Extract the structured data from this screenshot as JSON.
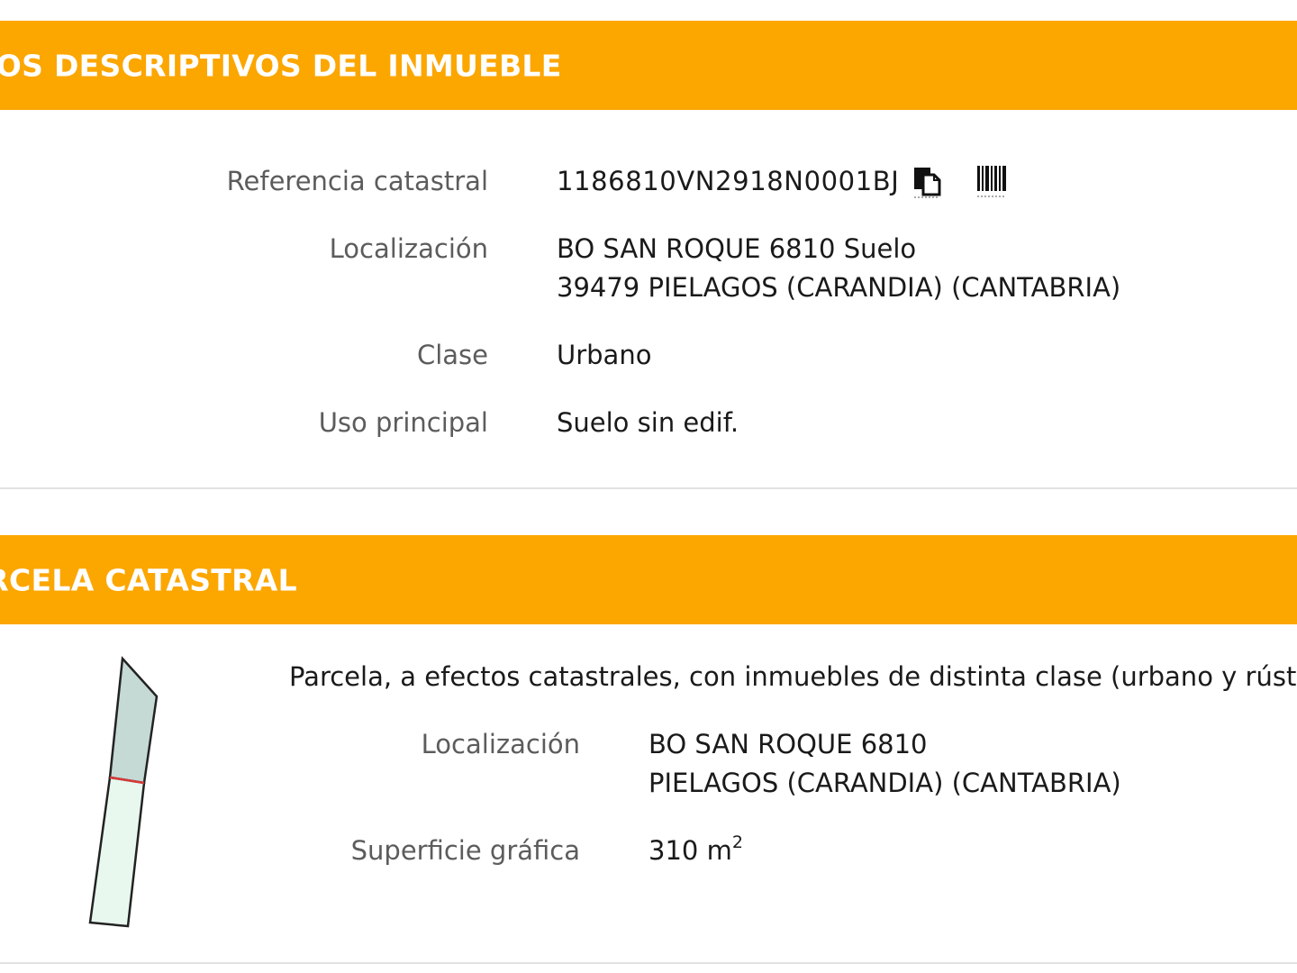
{
  "section1": {
    "title": "DATOS DESCRIPTIVOS DEL INMUEBLE",
    "ref_label": "Referencia catastral",
    "ref_value": "1186810VN2918N0001BJ",
    "loc_label": "Localización",
    "loc_line1": "BO SAN ROQUE 6810 Suelo",
    "loc_line2": "39479 PIELAGOS (CARANDIA) (CANTABRIA)",
    "clase_label": "Clase",
    "clase_value": "Urbano",
    "uso_label": "Uso principal",
    "uso_value": "Suelo sin edif.",
    "icons": [
      "copy-icon",
      "barcode-icon"
    ]
  },
  "section2": {
    "title": "PARCELA CATASTRAL",
    "note": "Parcela, a efectos catastrales, con inmuebles de distinta clase (urbano y rústico)",
    "loc_label": "Localización",
    "loc_line1": "BO SAN ROQUE 6810",
    "loc_line2": "PIELAGOS (CARANDIA) (CANTABRIA)",
    "sup_label": "Superficie gráfica",
    "sup_value": "310 m",
    "sup_unit_exp": "2"
  },
  "colors": {
    "header_bg": "#fca600",
    "header_text": "#ffffff",
    "label_text": "#5c5c5c",
    "value_text": "#1a1a1a",
    "parcel_urban_fill": "#c5d9d5",
    "parcel_rustic_fill": "#e8f8ef",
    "parcel_split_line": "#d83a3a"
  }
}
